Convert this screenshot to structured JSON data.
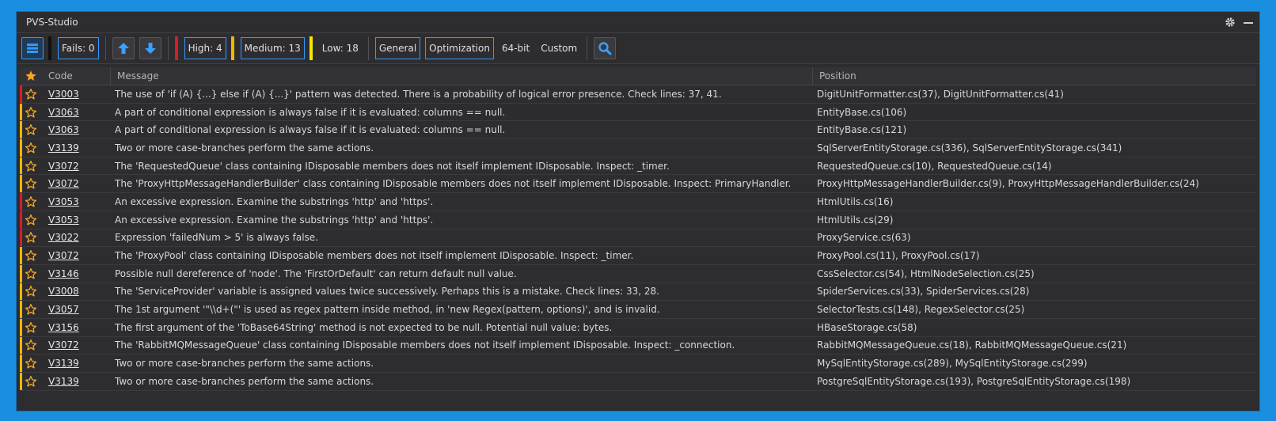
{
  "window": {
    "title": "PVS-Studio"
  },
  "toolbar": {
    "fails_label": "Fails: 0",
    "high_label": "High: 4",
    "medium_label": "Medium: 13",
    "low_label": "Low: 18",
    "general_label": "General",
    "optimization_label": "Optimization",
    "bit64_label": "64-bit",
    "custom_label": "Custom"
  },
  "colors": {
    "high": "#d11f2a",
    "medium": "#f2b705",
    "low": "#f4e60a",
    "accent": "#3399ff"
  },
  "table": {
    "headers": {
      "code": "Code",
      "message": "Message",
      "position": "Position"
    },
    "rows": [
      {
        "level": "high",
        "code": "V3003",
        "message": "The use of 'if (A) {...} else if (A) {...}' pattern was detected. There is a probability of logical error presence. Check lines: 37, 41.",
        "position": "DigitUnitFormatter.cs(37), DigitUnitFormatter.cs(41)"
      },
      {
        "level": "medium",
        "code": "V3063",
        "message": "A part of conditional expression is always false if it is evaluated: columns == null.",
        "position": "EntityBase.cs(106)"
      },
      {
        "level": "medium",
        "code": "V3063",
        "message": "A part of conditional expression is always false if it is evaluated: columns == null.",
        "position": "EntityBase.cs(121)"
      },
      {
        "level": "medium",
        "code": "V3139",
        "message": "Two or more case-branches perform the same actions.",
        "position": "SqlServerEntityStorage.cs(336), SqlServerEntityStorage.cs(341)"
      },
      {
        "level": "medium",
        "code": "V3072",
        "message": "The 'RequestedQueue' class containing IDisposable members does not itself implement IDisposable. Inspect: _timer.",
        "position": "RequestedQueue.cs(10), RequestedQueue.cs(14)"
      },
      {
        "level": "medium",
        "code": "V3072",
        "message": "The 'ProxyHttpMessageHandlerBuilder' class containing IDisposable members does not itself implement IDisposable. Inspect: PrimaryHandler.",
        "position": "ProxyHttpMessageHandlerBuilder.cs(9), ProxyHttpMessageHandlerBuilder.cs(24)"
      },
      {
        "level": "high",
        "code": "V3053",
        "message": "An excessive expression. Examine the substrings 'http' and 'https'.",
        "position": "HtmlUtils.cs(16)"
      },
      {
        "level": "high",
        "code": "V3053",
        "message": "An excessive expression. Examine the substrings 'http' and 'https'.",
        "position": "HtmlUtils.cs(29)"
      },
      {
        "level": "high",
        "code": "V3022",
        "message": "Expression 'failedNum > 5' is always false.",
        "position": "ProxyService.cs(63)"
      },
      {
        "level": "medium",
        "code": "V3072",
        "message": "The 'ProxyPool' class containing IDisposable members does not itself implement IDisposable. Inspect: _timer.",
        "position": "ProxyPool.cs(11), ProxyPool.cs(17)"
      },
      {
        "level": "medium",
        "code": "V3146",
        "message": "Possible null dereference of 'node'. The 'FirstOrDefault' can return default null value.",
        "position": "CssSelector.cs(54), HtmlNodeSelection.cs(25)"
      },
      {
        "level": "medium",
        "code": "V3008",
        "message": "The 'ServiceProvider' variable is assigned values twice successively. Perhaps this is a mistake. Check lines: 33, 28.",
        "position": "SpiderServices.cs(33), SpiderServices.cs(28)"
      },
      {
        "level": "medium",
        "code": "V3057",
        "message": "The 1st argument '\"\\\\d+(\"' is used as regex pattern inside method, in 'new Regex(pattern, options)', and is invalid.",
        "position": "SelectorTests.cs(148), RegexSelector.cs(25)"
      },
      {
        "level": "medium",
        "code": "V3156",
        "message": "The first argument of the 'ToBase64String' method is not expected to be null. Potential null value: bytes.",
        "position": "HBaseStorage.cs(58)"
      },
      {
        "level": "medium",
        "code": "V3072",
        "message": "The 'RabbitMQMessageQueue' class containing IDisposable members does not itself implement IDisposable. Inspect: _connection.",
        "position": "RabbitMQMessageQueue.cs(18), RabbitMQMessageQueue.cs(21)"
      },
      {
        "level": "medium",
        "code": "V3139",
        "message": "Two or more case-branches perform the same actions.",
        "position": "MySqlEntityStorage.cs(289), MySqlEntityStorage.cs(299)"
      },
      {
        "level": "medium",
        "code": "V3139",
        "message": "Two or more case-branches perform the same actions.",
        "position": "PostgreSqlEntityStorage.cs(193), PostgreSqlEntityStorage.cs(198)"
      }
    ]
  }
}
